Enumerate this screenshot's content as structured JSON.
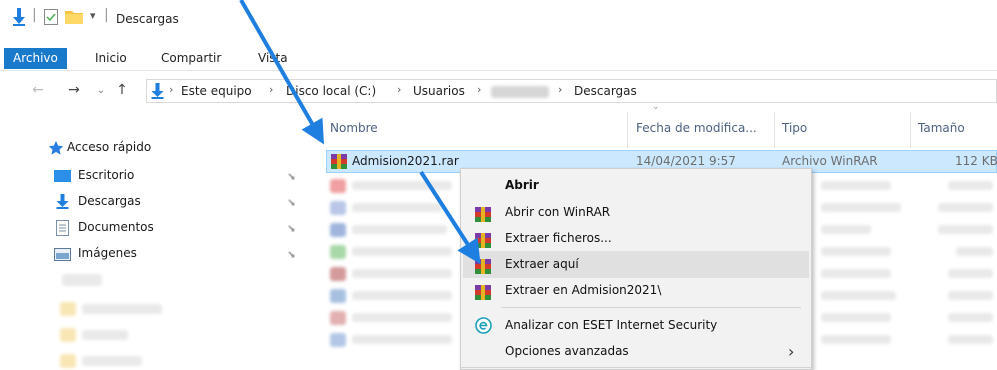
{
  "window": {
    "title": "Descargas",
    "quick_access_separator": "|",
    "quick_access_dropdown": "▾"
  },
  "ribbon": {
    "tabs": [
      {
        "label": "Archivo",
        "active": true
      },
      {
        "label": "Inicio",
        "active": false
      },
      {
        "label": "Compartir",
        "active": false
      },
      {
        "label": "Vista",
        "active": false
      }
    ]
  },
  "address_bar": {
    "crumbs": [
      "Este equipo",
      "Disco local (C:)",
      "Usuarios",
      "Descargas"
    ],
    "separator": "›"
  },
  "sidebar": {
    "quick_access_label": "Acceso rápido",
    "items": [
      {
        "label": "Escritorio",
        "icon": "desktop-icon"
      },
      {
        "label": "Descargas",
        "icon": "downloads-icon"
      },
      {
        "label": "Documentos",
        "icon": "documents-icon"
      },
      {
        "label": "Imágenes",
        "icon": "pictures-icon"
      }
    ]
  },
  "file_list": {
    "columns": [
      "Nombre",
      "Fecha de modifica...",
      "Tipo",
      "Tamaño"
    ],
    "selected_row": {
      "name": "Admision2021.rar",
      "date": "14/04/2021 9:57",
      "type": "Archivo WinRAR",
      "size": "112 KB"
    }
  },
  "context_menu": {
    "items": [
      {
        "label": "Abrir",
        "bold": true,
        "icon": null
      },
      {
        "label": "Abrir con WinRAR",
        "icon": "winrar-icon"
      },
      {
        "label": "Extraer ficheros...",
        "icon": "winrar-icon"
      },
      {
        "label": "Extraer aquí",
        "icon": "winrar-icon",
        "hover": true
      },
      {
        "label": "Extraer en Admision2021\\",
        "icon": "winrar-icon"
      },
      {
        "label": "Analizar con ESET Internet Security",
        "icon": "eset-icon"
      },
      {
        "label": "Opciones avanzadas",
        "icon": null,
        "submenu": true
      }
    ],
    "submenu_chevron": "›"
  },
  "colors": {
    "accent": "#1979ca",
    "selection": "#cce8ff",
    "annotation_arrow": "#1e7fe0"
  }
}
